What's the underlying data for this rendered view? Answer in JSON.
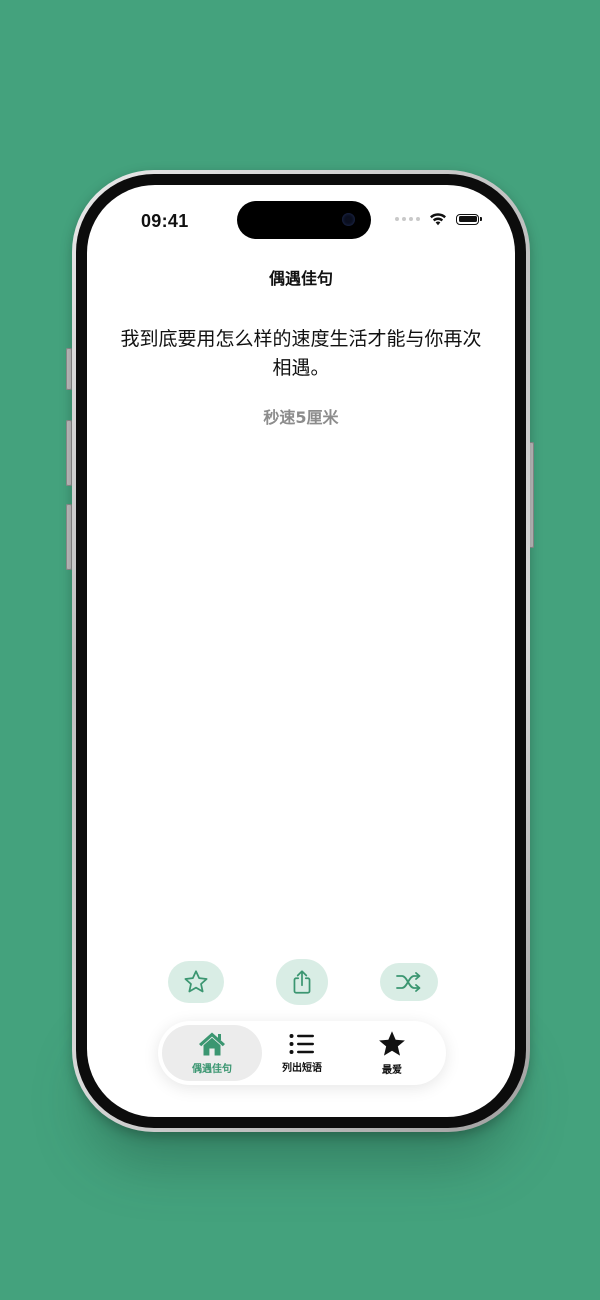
{
  "colors": {
    "background": "#44a27d",
    "accent": "#3b9671",
    "action_button_bg": "#d9ede5",
    "secondary_text": "#8c8c8c"
  },
  "status_bar": {
    "time": "09:41",
    "icons": [
      "signal-dots-icon",
      "wifi-icon",
      "battery-icon"
    ]
  },
  "nav": {
    "title": "偶遇佳句"
  },
  "quote": {
    "text": "我到底要用怎么样的速度生活才能与你再次相遇。",
    "author": "秒速5厘米"
  },
  "actions": [
    {
      "name": "favorite-button",
      "icon": "star-outline-icon"
    },
    {
      "name": "share-button",
      "icon": "share-icon"
    },
    {
      "name": "shuffle-button",
      "icon": "shuffle-icon"
    }
  ],
  "tabs": [
    {
      "label": "偶遇佳句",
      "icon": "home-icon",
      "active": true
    },
    {
      "label": "列出短语",
      "icon": "list-icon",
      "active": false
    },
    {
      "label": "最爱",
      "icon": "star-filled-icon",
      "active": false
    }
  ]
}
